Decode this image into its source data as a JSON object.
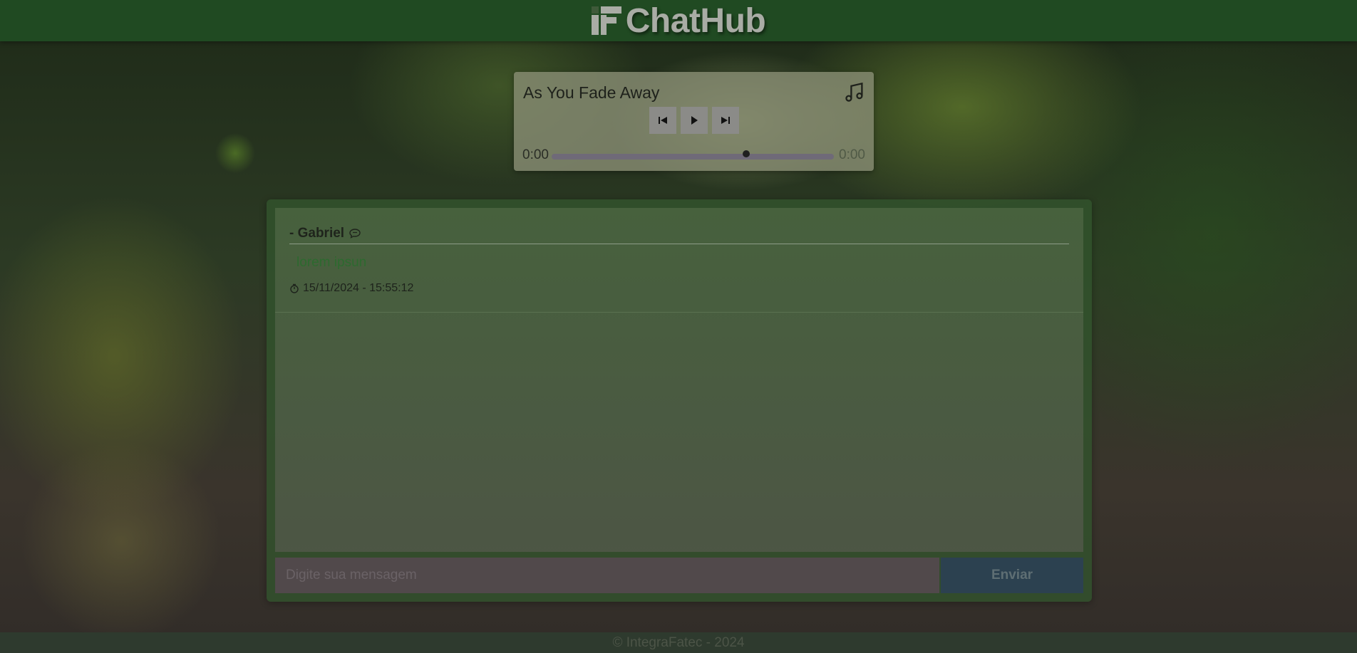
{
  "header": {
    "app_name": "ChatHub",
    "logo_icon": "chathub-logo-icon"
  },
  "player": {
    "song_title": "As You Fade Away",
    "music_icon": "music-note-icon",
    "controls": {
      "previous": "skip-previous-icon",
      "play": "play-icon",
      "next": "skip-next-icon"
    },
    "current_time": "0:00",
    "duration": "0:00",
    "progress_fraction": 0.69
  },
  "chat": {
    "messages": [
      {
        "author": "- Gabriel",
        "author_icon": "speech-bubble-icon",
        "text": "lorem ipsun",
        "time_icon": "timer-icon",
        "timestamp": "15/11/2024 - 15:55:12"
      }
    ],
    "composer": {
      "placeholder": "Digite sua mensagem",
      "send_label": "Enviar"
    }
  },
  "footer": {
    "text": "© IntegraFatec - 2024"
  },
  "colors": {
    "header": "#204a22",
    "send_button": "#2c4150",
    "message_text": "#2d6a2f"
  }
}
